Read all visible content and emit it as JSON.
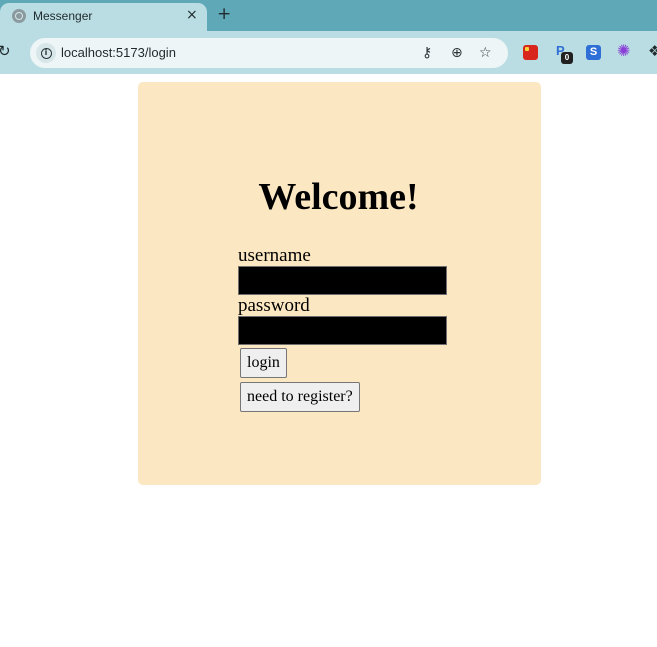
{
  "browser": {
    "tab": {
      "title": "Messenger",
      "close_glyph": "×"
    },
    "new_tab_glyph": "+",
    "reload_glyph": "↻",
    "url": "localhost:5173/login",
    "icons": [
      "site-info-icon",
      "password-key-icon",
      "zoom-icon",
      "bookmark-star-icon"
    ],
    "extensions": {
      "badge_count": "0",
      "s_letter": "S",
      "p_letter": "P"
    }
  },
  "page": {
    "heading": "Welcome!",
    "username_label": "username",
    "username_value": "",
    "password_label": "password",
    "password_value": "",
    "login_button": "login",
    "register_button": "need to register?"
  },
  "colors": {
    "tab_bar": "#5fa8b8",
    "toolbar": "#b9dde3",
    "card_background": "#fbe7c2",
    "input_background": "#000000"
  }
}
